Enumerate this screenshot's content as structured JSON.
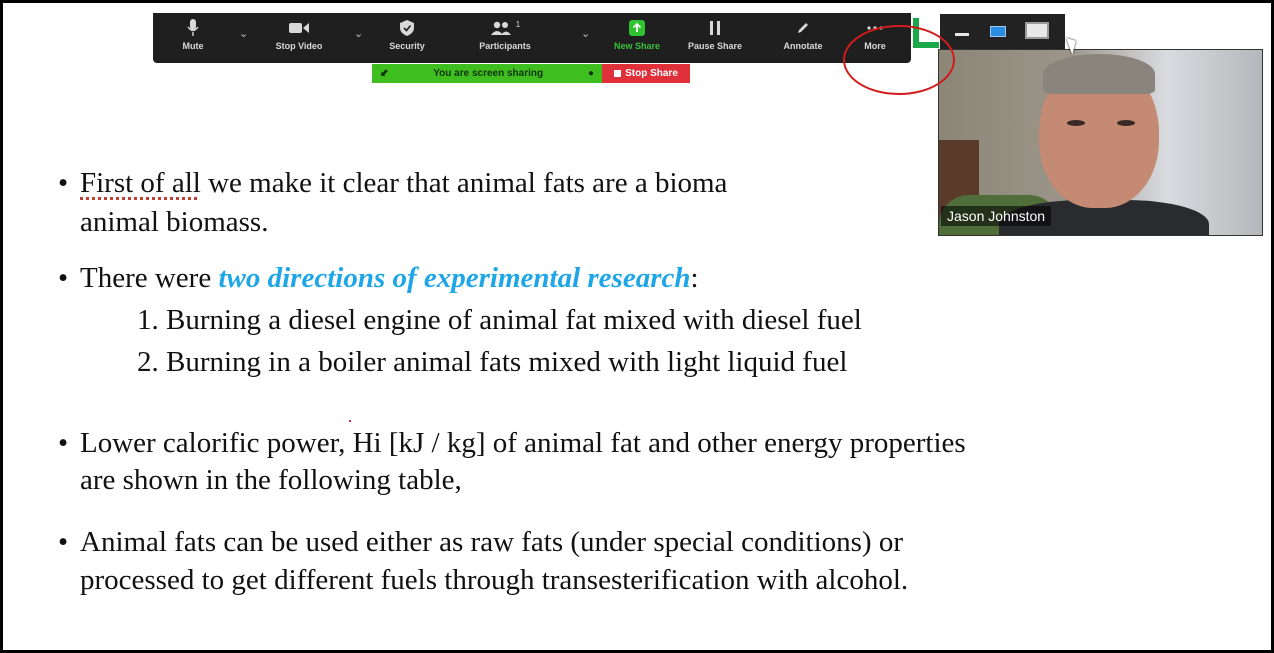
{
  "toolbar": {
    "mute": "Mute",
    "stop_video": "Stop Video",
    "security": "Security",
    "participants": "Participants",
    "participants_count": "1",
    "new_share": "New Share",
    "pause_share": "Pause Share",
    "annotate": "Annotate",
    "more": "More"
  },
  "share_banner": {
    "status": "You are screen sharing",
    "stop": "Stop Share"
  },
  "video": {
    "participant_name": "Jason Johnston"
  },
  "slide": {
    "bullet1_line1_a": "First of all",
    "bullet1_line1_b": " we make it clear that animal fats are a bioma",
    "bullet1_line2": "animal biomass.",
    "bullet2_prefix": "There were ",
    "bullet2_accent": "two directions of experimental research",
    "bullet2_suffix": ":",
    "item1": "1. Burning a diesel engine of animal fat mixed with diesel fuel",
    "item2": "2. Burning in a boiler animal fats mixed with light liquid fuel",
    "bullet3_line1": "Lower calorific power, Hi [kJ / kg] of animal fat and other energy properties",
    "bullet3_line2": "are shown in the following table,",
    "bullet4_line1": "Animal fats can be used either as raw fats (under special conditions) or",
    "bullet4_line2": "processed to get different fuels through transesterification with alcohol."
  },
  "colors": {
    "accent": "#1fa6e6",
    "share_green": "#3fbf1f",
    "stop_red": "#e0303a",
    "annotation_red": "#d21c1c"
  }
}
